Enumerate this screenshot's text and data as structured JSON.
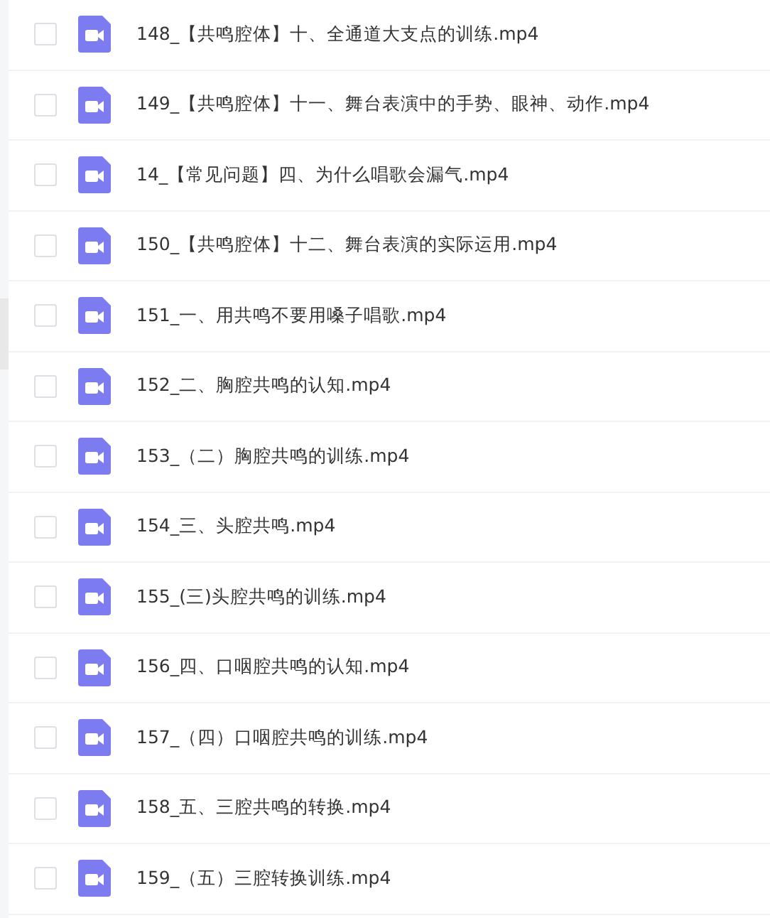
{
  "files": [
    {
      "name": "148_【共鸣腔体】十、全通道大支点的训练.mp4",
      "checked": false
    },
    {
      "name": "149_【共鸣腔体】十一、舞台表演中的手势、眼神、动作.mp4",
      "checked": false
    },
    {
      "name": "14_【常见问题】四、为什么唱歌会漏气.mp4",
      "checked": false
    },
    {
      "name": "150_【共鸣腔体】十二、舞台表演的实际运用.mp4",
      "checked": false
    },
    {
      "name": "151_一、用共鸣不要用嗓子唱歌.mp4",
      "checked": false
    },
    {
      "name": "152_二、胸腔共鸣的认知.mp4",
      "checked": false
    },
    {
      "name": "153_（二）胸腔共鸣的训练.mp4",
      "checked": false
    },
    {
      "name": "154_三、头腔共鸣.mp4",
      "checked": false
    },
    {
      "name": "155_(三)头腔共鸣的训练.mp4",
      "checked": false
    },
    {
      "name": "156_四、口咽腔共鸣的认知.mp4",
      "checked": false
    },
    {
      "name": "157_（四）口咽腔共鸣的训练.mp4",
      "checked": false
    },
    {
      "name": "158_五、三腔共鸣的转换.mp4",
      "checked": false
    },
    {
      "name": "159_（五）三腔转换训练.mp4",
      "checked": false
    }
  ]
}
